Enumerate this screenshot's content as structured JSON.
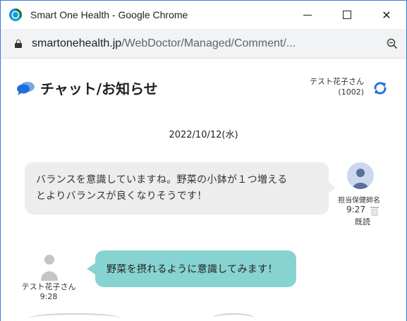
{
  "browser": {
    "window_title": "Smart One Health - Google Chrome",
    "url_host": "smartonehealth.jp",
    "url_path": "/WebDoctor/Managed/Comment/...",
    "controls": {
      "minimize": "–",
      "maximize": "☐",
      "close": "✕"
    }
  },
  "page": {
    "title": "チャット/お知らせ",
    "user_name": "テスト花子さん",
    "user_id": "(1002)",
    "date": "2022/10/12(水)"
  },
  "messages": [
    {
      "from": "staff",
      "lines": [
        "バランスを意識していますね。野菜の小鉢が１つ増える",
        "とよりバランスが良くなりそうです！"
      ],
      "sender": "担当保健師名",
      "time": "9:27",
      "status": "既読"
    },
    {
      "from": "user",
      "text": "野菜を摂れるように意識してみます！",
      "sender": "テスト花子さん",
      "time": "9:28"
    }
  ],
  "colors": {
    "accent_blue": "#1e6fd9",
    "staff_bubble": "#ededed",
    "user_bubble": "#87d3d1",
    "avatar_bg": "#cdd7ef",
    "avatar_figure": "#5a6f99"
  },
  "icons": {
    "chat": "chat-bubbles-icon",
    "refresh": "refresh-icon",
    "trash": "trash-icon",
    "lock": "lock-icon",
    "zoom": "zoom-icon"
  }
}
